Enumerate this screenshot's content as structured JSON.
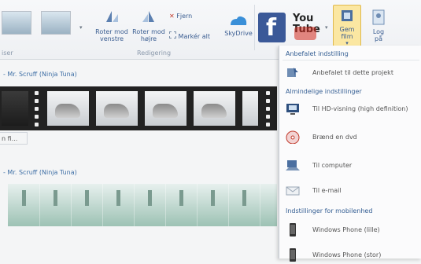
{
  "ribbon": {
    "left_group_label": "iser",
    "rotate_left": "Roter mod venstre",
    "rotate_right": "Roter mod højre",
    "remove": "Fjern",
    "select_all": "Markér alt",
    "edit_group_label": "Redigering",
    "skydrive": "SkyDrive",
    "youtube": "You Tube",
    "save_movie": "Gem film",
    "log_on": "Log på"
  },
  "timeline": {
    "track1_title": "- Mr. Scruff (Ninja Tuna)",
    "track1_caption": "n fi...",
    "track2_title": "- Mr. Scruff (Ninja Tuna)"
  },
  "save_menu": {
    "recommended_header": "Anbefalet indstilling",
    "recommended_item": "Anbefalet til dette projekt",
    "general_header": "Almindelige indstillinger",
    "hd_item": "Til HD-visning (high definition)",
    "dvd_item": "Brænd en dvd",
    "computer_item": "Til computer",
    "email_item": "Til e-mail",
    "mobile_header": "Indstillinger for mobilenhed",
    "wp_small_item": "Windows Phone (lille)",
    "wp_large_item": "Windows Phone (stor)"
  },
  "colors": {
    "accent": "#3a5d91",
    "facebook": "#3b5998",
    "youtube_red": "#d32a1e",
    "save_highlight": "#fbe7a2"
  }
}
